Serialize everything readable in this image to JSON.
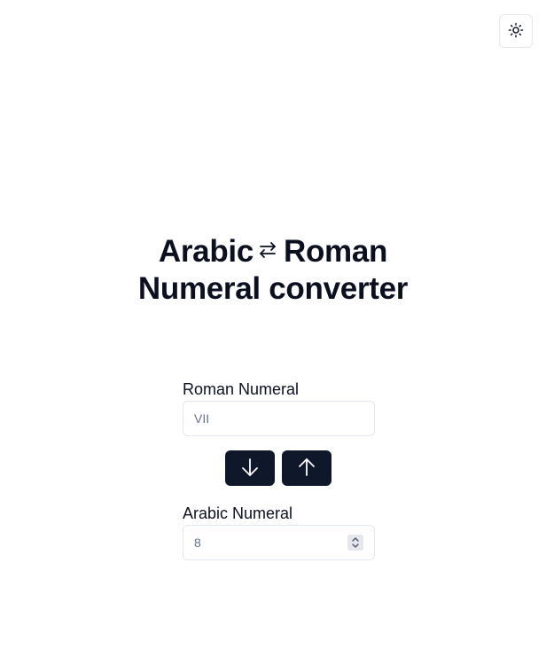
{
  "header": {
    "theme_toggle_icon": "sun-icon"
  },
  "title": {
    "line1_left": "Arabic",
    "swap_icon": "swap-arrows-icon",
    "line1_right": "Roman",
    "line2": "Numeral converter"
  },
  "roman": {
    "label": "Roman Numeral",
    "placeholder": "VII",
    "value": ""
  },
  "buttons": {
    "to_arabic_icon": "arrow-down-icon",
    "to_roman_icon": "arrow-up-icon"
  },
  "arabic": {
    "label": "Arabic Numeral",
    "placeholder": "8",
    "value": ""
  },
  "colors": {
    "button_bg": "#0f172a",
    "border": "#e2e8f0",
    "text": "#0b1020"
  }
}
